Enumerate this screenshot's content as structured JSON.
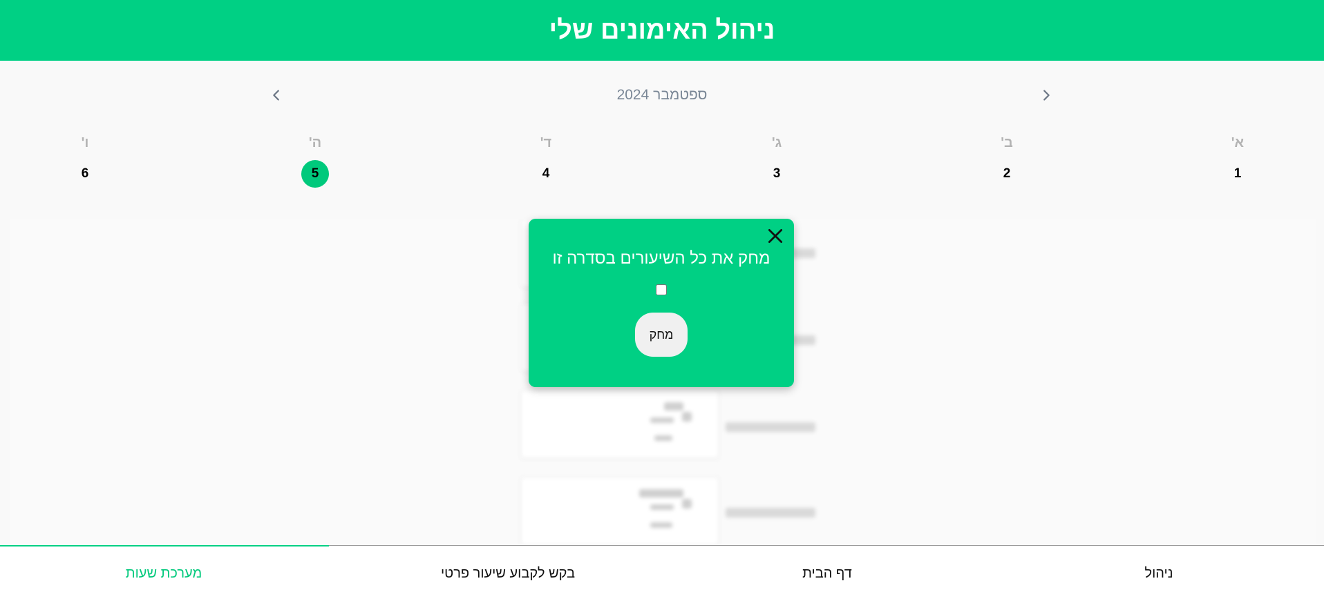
{
  "header": {
    "title": "ניהול האימונים שלי"
  },
  "calendar": {
    "month_label": "ספטמבר 2024",
    "days": [
      {
        "name": "א'",
        "number": "1"
      },
      {
        "name": "ב'",
        "number": "2"
      },
      {
        "name": "ג'",
        "number": "3"
      },
      {
        "name": "ד'",
        "number": "4"
      },
      {
        "name": "ה'",
        "number": "5",
        "selected": true
      },
      {
        "name": "ו'",
        "number": "6"
      }
    ],
    "icons": {
      "prev": "chevron-left-icon",
      "next": "chevron-right-icon"
    }
  },
  "modal": {
    "title": "מחק את כל השיעורים בסדרה זו",
    "checkbox_checked": false,
    "delete_label": "מחק",
    "close_icon": "close-icon"
  },
  "bottom_nav": {
    "items": [
      {
        "label": "ניהול"
      },
      {
        "label": "דף הבית"
      },
      {
        "label": "בקש לקבוע שיעור פרטי"
      },
      {
        "label": "מערכת שעות",
        "active": true
      }
    ]
  },
  "colors": {
    "accent": "#00d084",
    "selected_day": "#00c97c",
    "muted_text": "#7a8796"
  }
}
